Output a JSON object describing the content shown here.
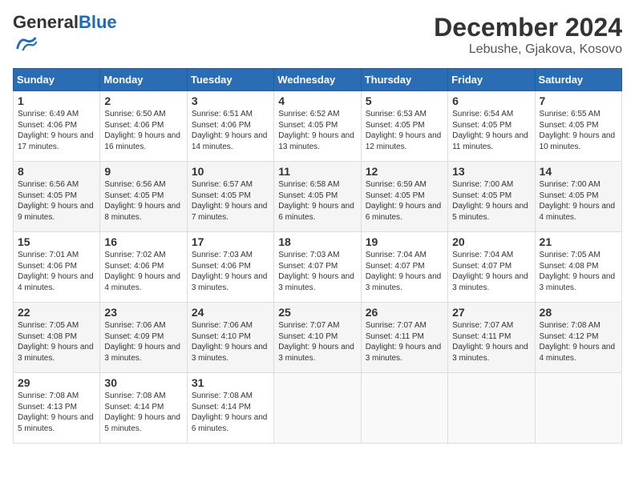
{
  "logo": {
    "general": "General",
    "blue": "Blue"
  },
  "title": "December 2024",
  "subtitle": "Lebushe, Gjakova, Kosovo",
  "days_of_week": [
    "Sunday",
    "Monday",
    "Tuesday",
    "Wednesday",
    "Thursday",
    "Friday",
    "Saturday"
  ],
  "weeks": [
    [
      {
        "day": "1",
        "sunrise": "6:49 AM",
        "sunset": "4:06 PM",
        "daylight": "9 hours and 17 minutes."
      },
      {
        "day": "2",
        "sunrise": "6:50 AM",
        "sunset": "4:06 PM",
        "daylight": "9 hours and 16 minutes."
      },
      {
        "day": "3",
        "sunrise": "6:51 AM",
        "sunset": "4:06 PM",
        "daylight": "9 hours and 14 minutes."
      },
      {
        "day": "4",
        "sunrise": "6:52 AM",
        "sunset": "4:05 PM",
        "daylight": "9 hours and 13 minutes."
      },
      {
        "day": "5",
        "sunrise": "6:53 AM",
        "sunset": "4:05 PM",
        "daylight": "9 hours and 12 minutes."
      },
      {
        "day": "6",
        "sunrise": "6:54 AM",
        "sunset": "4:05 PM",
        "daylight": "9 hours and 11 minutes."
      },
      {
        "day": "7",
        "sunrise": "6:55 AM",
        "sunset": "4:05 PM",
        "daylight": "9 hours and 10 minutes."
      }
    ],
    [
      {
        "day": "8",
        "sunrise": "6:56 AM",
        "sunset": "4:05 PM",
        "daylight": "9 hours and 9 minutes."
      },
      {
        "day": "9",
        "sunrise": "6:56 AM",
        "sunset": "4:05 PM",
        "daylight": "9 hours and 8 minutes."
      },
      {
        "day": "10",
        "sunrise": "6:57 AM",
        "sunset": "4:05 PM",
        "daylight": "9 hours and 7 minutes."
      },
      {
        "day": "11",
        "sunrise": "6:58 AM",
        "sunset": "4:05 PM",
        "daylight": "9 hours and 6 minutes."
      },
      {
        "day": "12",
        "sunrise": "6:59 AM",
        "sunset": "4:05 PM",
        "daylight": "9 hours and 6 minutes."
      },
      {
        "day": "13",
        "sunrise": "7:00 AM",
        "sunset": "4:05 PM",
        "daylight": "9 hours and 5 minutes."
      },
      {
        "day": "14",
        "sunrise": "7:00 AM",
        "sunset": "4:05 PM",
        "daylight": "9 hours and 4 minutes."
      }
    ],
    [
      {
        "day": "15",
        "sunrise": "7:01 AM",
        "sunset": "4:06 PM",
        "daylight": "9 hours and 4 minutes."
      },
      {
        "day": "16",
        "sunrise": "7:02 AM",
        "sunset": "4:06 PM",
        "daylight": "9 hours and 4 minutes."
      },
      {
        "day": "17",
        "sunrise": "7:03 AM",
        "sunset": "4:06 PM",
        "daylight": "9 hours and 3 minutes."
      },
      {
        "day": "18",
        "sunrise": "7:03 AM",
        "sunset": "4:07 PM",
        "daylight": "9 hours and 3 minutes."
      },
      {
        "day": "19",
        "sunrise": "7:04 AM",
        "sunset": "4:07 PM",
        "daylight": "9 hours and 3 minutes."
      },
      {
        "day": "20",
        "sunrise": "7:04 AM",
        "sunset": "4:07 PM",
        "daylight": "9 hours and 3 minutes."
      },
      {
        "day": "21",
        "sunrise": "7:05 AM",
        "sunset": "4:08 PM",
        "daylight": "9 hours and 3 minutes."
      }
    ],
    [
      {
        "day": "22",
        "sunrise": "7:05 AM",
        "sunset": "4:08 PM",
        "daylight": "9 hours and 3 minutes."
      },
      {
        "day": "23",
        "sunrise": "7:06 AM",
        "sunset": "4:09 PM",
        "daylight": "9 hours and 3 minutes."
      },
      {
        "day": "24",
        "sunrise": "7:06 AM",
        "sunset": "4:10 PM",
        "daylight": "9 hours and 3 minutes."
      },
      {
        "day": "25",
        "sunrise": "7:07 AM",
        "sunset": "4:10 PM",
        "daylight": "9 hours and 3 minutes."
      },
      {
        "day": "26",
        "sunrise": "7:07 AM",
        "sunset": "4:11 PM",
        "daylight": "9 hours and 3 minutes."
      },
      {
        "day": "27",
        "sunrise": "7:07 AM",
        "sunset": "4:11 PM",
        "daylight": "9 hours and 3 minutes."
      },
      {
        "day": "28",
        "sunrise": "7:08 AM",
        "sunset": "4:12 PM",
        "daylight": "9 hours and 4 minutes."
      }
    ],
    [
      {
        "day": "29",
        "sunrise": "7:08 AM",
        "sunset": "4:13 PM",
        "daylight": "9 hours and 5 minutes."
      },
      {
        "day": "30",
        "sunrise": "7:08 AM",
        "sunset": "4:14 PM",
        "daylight": "9 hours and 5 minutes."
      },
      {
        "day": "31",
        "sunrise": "7:08 AM",
        "sunset": "4:14 PM",
        "daylight": "9 hours and 6 minutes."
      },
      null,
      null,
      null,
      null
    ]
  ],
  "labels": {
    "sunrise": "Sunrise:",
    "sunset": "Sunset:",
    "daylight": "Daylight:"
  }
}
